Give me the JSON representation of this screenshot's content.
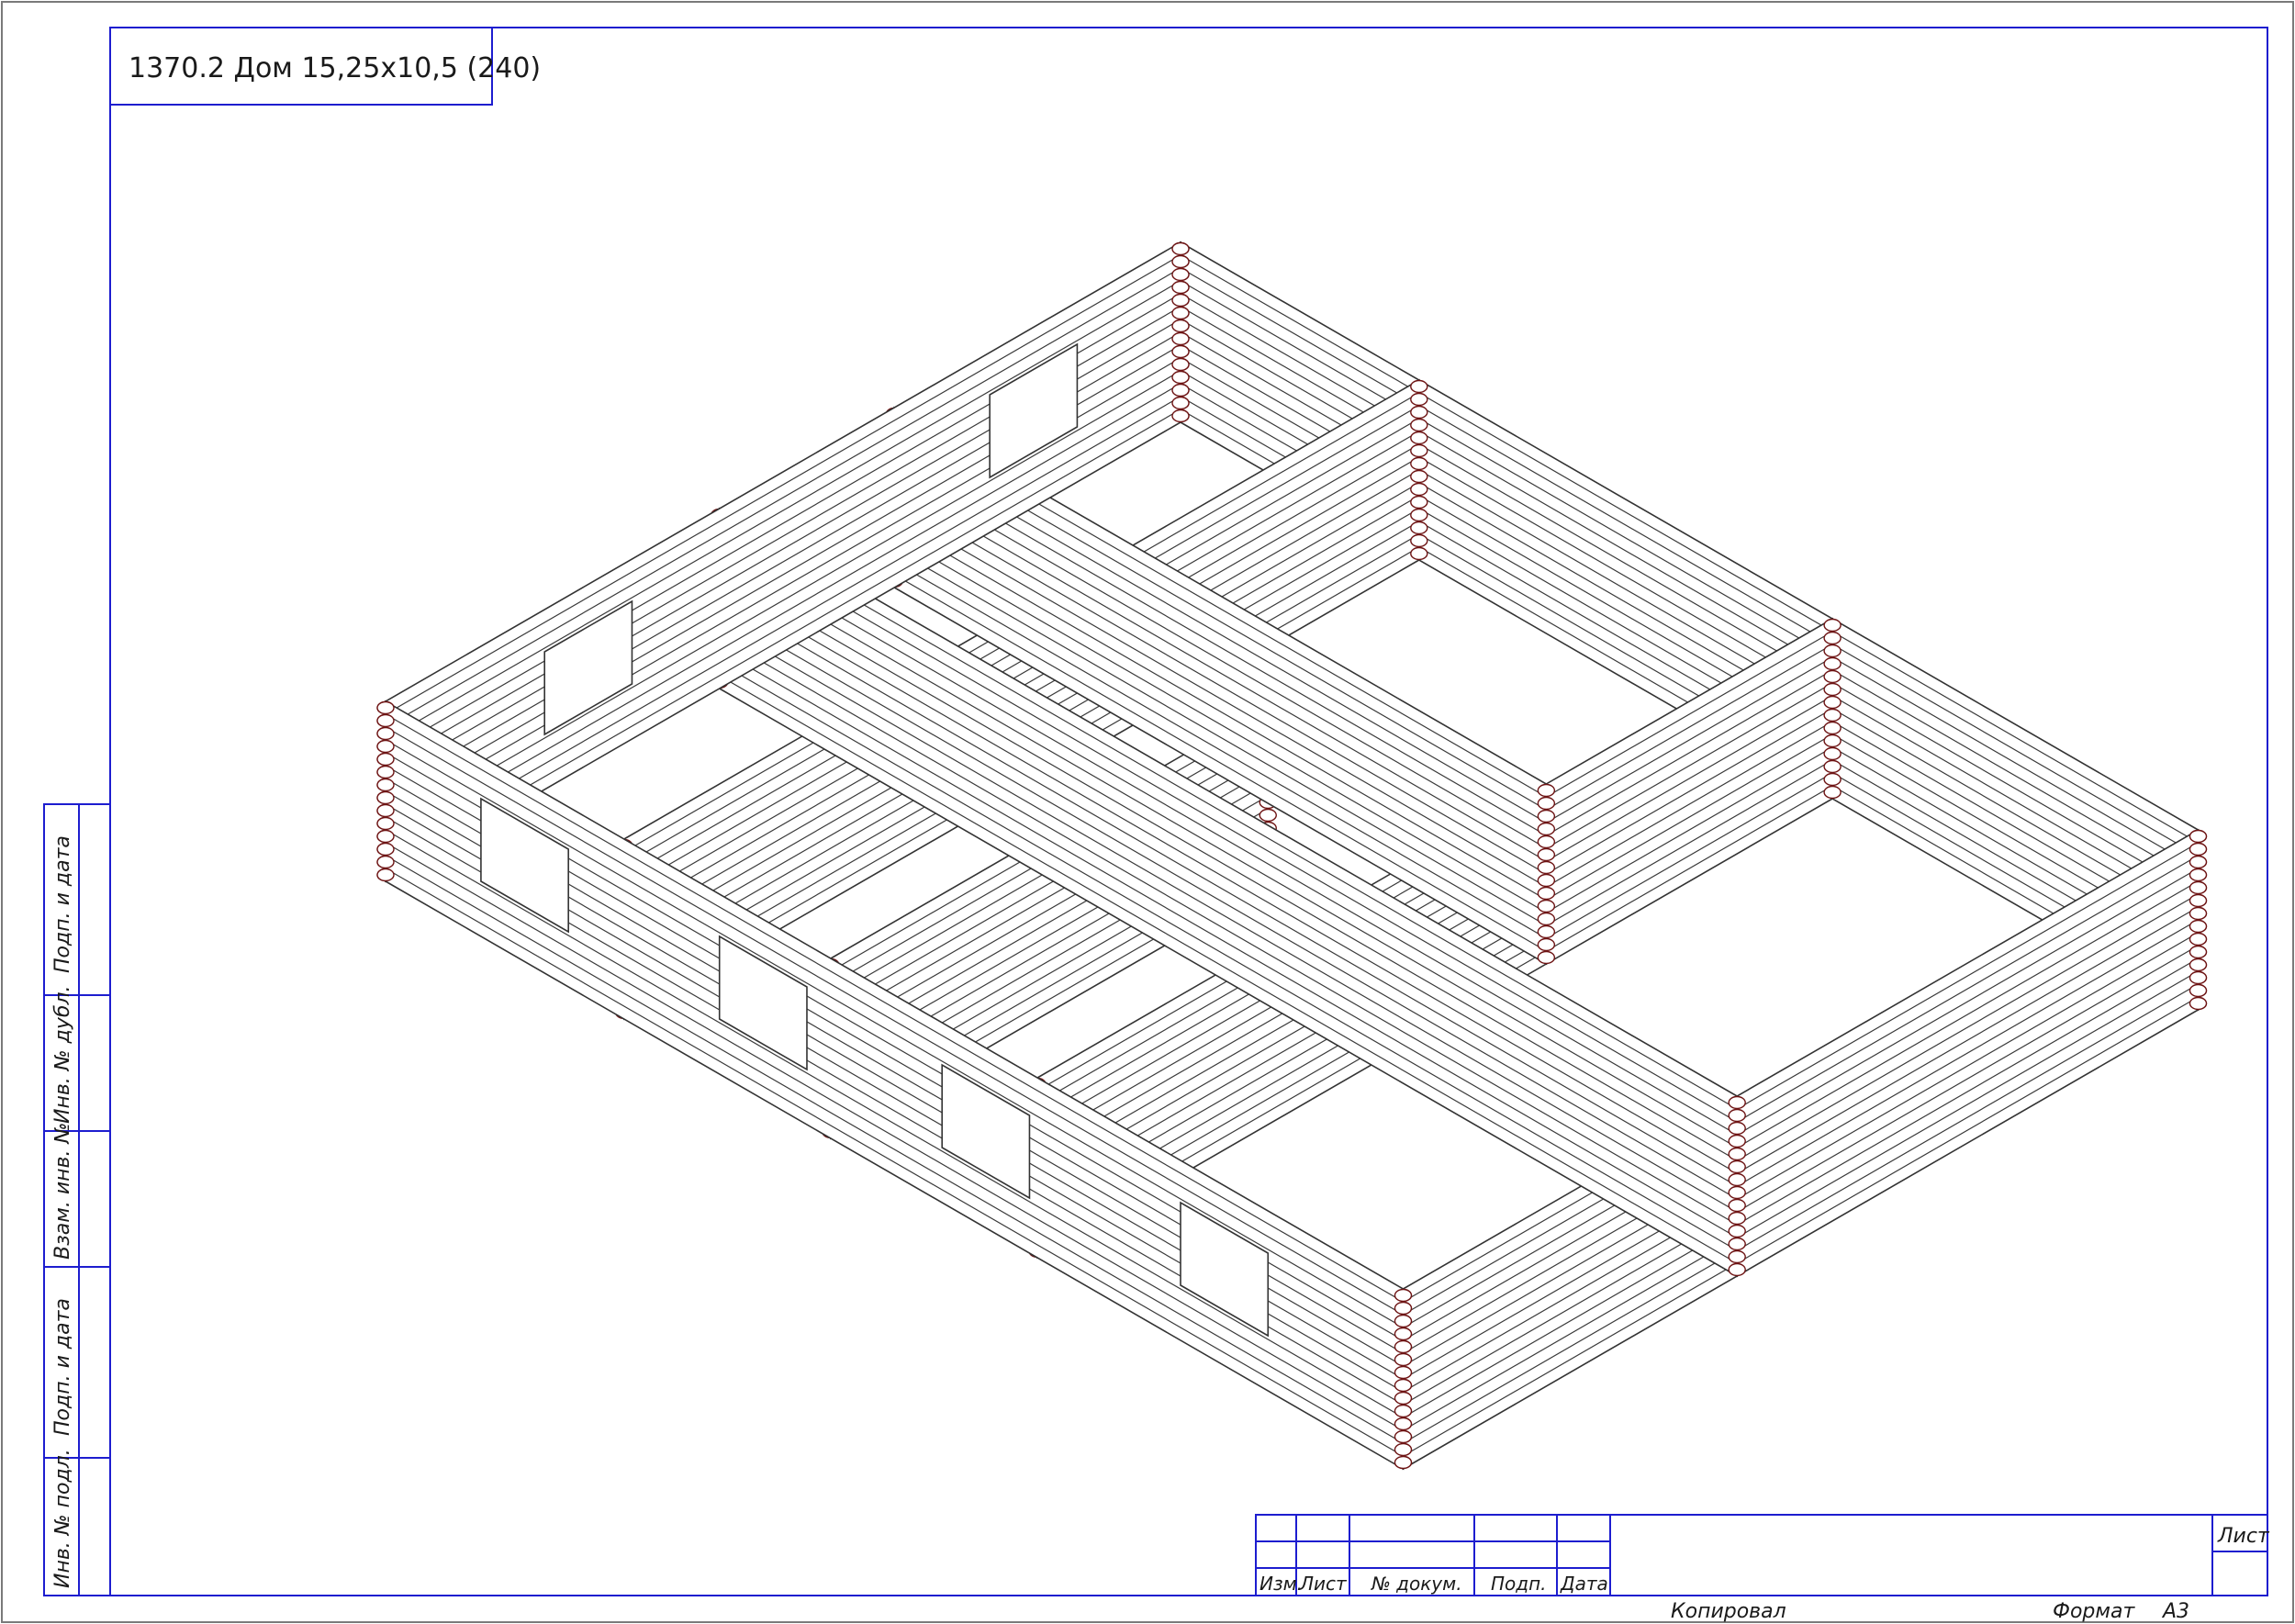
{
  "sheet_title": "1370.2 Дом 15,25х10,5 (240)",
  "side_stamp": {
    "cells": [
      "Подп. и дата",
      "Инв. № дубл.",
      "Взам. инв. №",
      "Подп. и дата",
      "Инв. № подл."
    ]
  },
  "title_block": {
    "columns": [
      "Изм.",
      "Лист",
      "№ докум.",
      "Подп.",
      "Дата"
    ],
    "sheet_label": "Лист"
  },
  "footer": {
    "copied": "Копировал",
    "format_label": "Формат",
    "format_value": "А3"
  },
  "colors": {
    "frame": "#1d1dcf",
    "outer_border": "#7a7a7a",
    "log_edge": "#6e1414",
    "text": "#1a1a1a"
  }
}
